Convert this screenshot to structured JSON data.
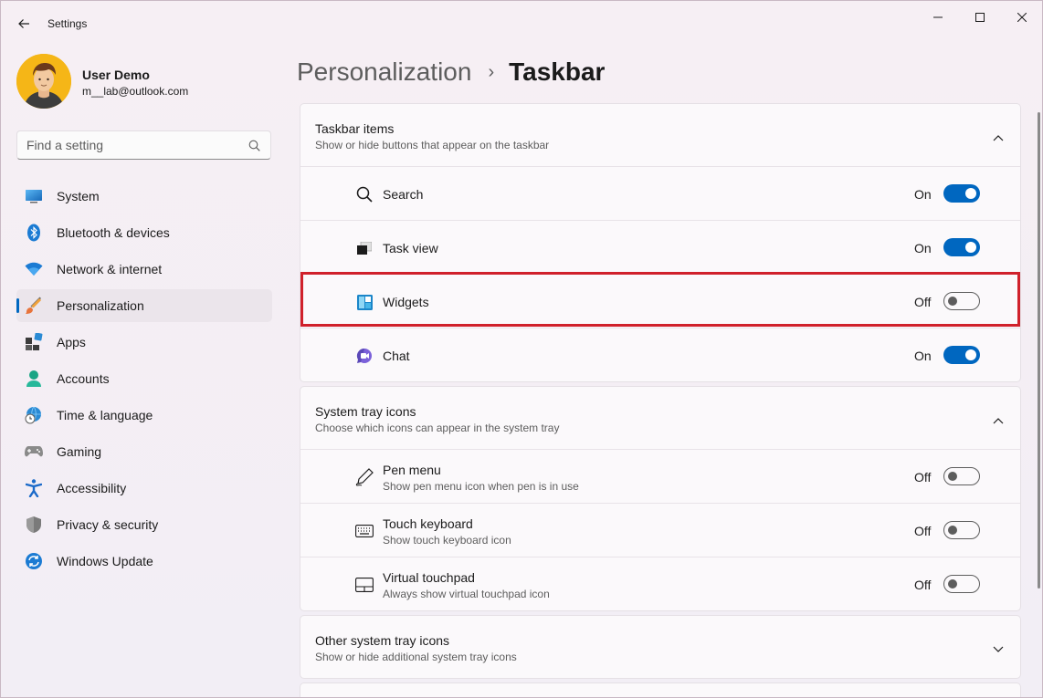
{
  "window": {
    "title": "Settings",
    "controls": [
      "minimize",
      "maximize",
      "close"
    ]
  },
  "profile": {
    "name": "User Demo",
    "email": "m__lab@outlook.com"
  },
  "search": {
    "placeholder": "Find a setting"
  },
  "sidebar": {
    "items": [
      {
        "label": "System",
        "icon": "system-icon"
      },
      {
        "label": "Bluetooth & devices",
        "icon": "bluetooth-icon"
      },
      {
        "label": "Network & internet",
        "icon": "wifi-icon"
      },
      {
        "label": "Personalization",
        "icon": "brush-icon",
        "selected": true
      },
      {
        "label": "Apps",
        "icon": "apps-icon"
      },
      {
        "label": "Accounts",
        "icon": "accounts-icon"
      },
      {
        "label": "Time & language",
        "icon": "globe-clock-icon"
      },
      {
        "label": "Gaming",
        "icon": "gamepad-icon"
      },
      {
        "label": "Accessibility",
        "icon": "accessibility-icon"
      },
      {
        "label": "Privacy & security",
        "icon": "shield-icon"
      },
      {
        "label": "Windows Update",
        "icon": "update-icon"
      }
    ]
  },
  "breadcrumb": {
    "parent": "Personalization",
    "separator": "›",
    "current": "Taskbar"
  },
  "taskbar_items": {
    "title": "Taskbar items",
    "subtitle": "Show or hide buttons that appear on the taskbar",
    "rows": [
      {
        "label": "Search",
        "state": "On",
        "icon": "search-icon"
      },
      {
        "label": "Task view",
        "state": "On",
        "icon": "task-view-icon"
      },
      {
        "label": "Widgets",
        "state": "Off",
        "icon": "widgets-icon"
      },
      {
        "label": "Chat",
        "state": "On",
        "icon": "chat-icon"
      }
    ]
  },
  "system_tray": {
    "title": "System tray icons",
    "subtitle": "Choose which icons can appear in the system tray",
    "rows": [
      {
        "label": "Pen menu",
        "sub": "Show pen menu icon when pen is in use",
        "state": "Off",
        "icon": "pen-icon"
      },
      {
        "label": "Touch keyboard",
        "sub": "Show touch keyboard icon",
        "state": "Off",
        "icon": "keyboard-icon"
      },
      {
        "label": "Virtual touchpad",
        "sub": "Always show virtual touchpad icon",
        "state": "Off",
        "icon": "touchpad-icon"
      }
    ]
  },
  "other_tray": {
    "title": "Other system tray icons",
    "subtitle": "Show or hide additional system tray icons"
  },
  "colors": {
    "accent": "#0067c0",
    "highlight": "#d0212b"
  }
}
